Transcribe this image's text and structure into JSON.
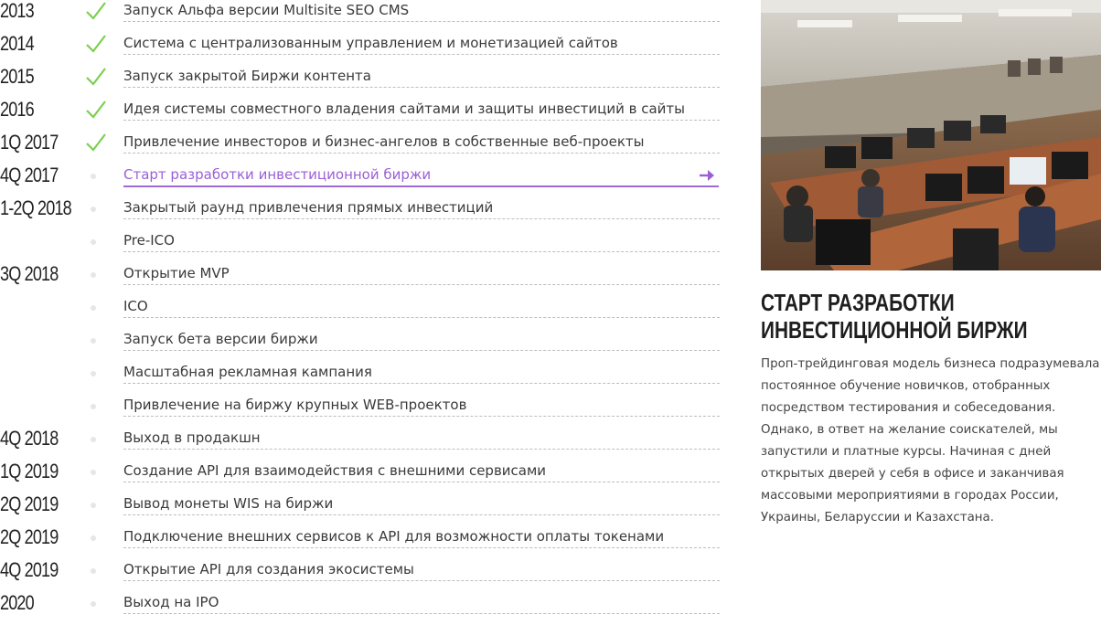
{
  "roadmap": {
    "rows": [
      {
        "year": "2013",
        "task": "Запуск Альфа версии Multisite SEO CMS",
        "status": "done"
      },
      {
        "year": "2014",
        "task": "Система с централизованным управлением и монетизацией сайтов",
        "status": "done"
      },
      {
        "year": "2015",
        "task": "Запуск закрытой Биржи контента",
        "status": "done"
      },
      {
        "year": "2016",
        "task": "Идея системы совместного владения сайтами и защиты инвестиций в сайты",
        "status": "done"
      },
      {
        "year": "1Q 2017",
        "task": "Привлечение инвесторов и бизнес-ангелов в собственные веб-проекты",
        "status": "done"
      },
      {
        "year": "4Q 2017",
        "task": "Старт разработки инвестиционной биржи",
        "status": "active"
      },
      {
        "year": "1-2Q 2018",
        "task": "Закрытый раунд привлечения прямых инвестиций",
        "status": "planned"
      },
      {
        "year": "",
        "task": "Pre-ICO",
        "status": "planned"
      },
      {
        "year": "3Q 2018",
        "task": "Открытие MVP",
        "status": "planned"
      },
      {
        "year": "",
        "task": "ICO",
        "status": "planned"
      },
      {
        "year": "",
        "task": "Запуск бета версии биржи",
        "status": "planned"
      },
      {
        "year": "",
        "task": "Масштабная рекламная кампания",
        "status": "planned"
      },
      {
        "year": "",
        "task": "Привлечение на биржу крупных WEB-проектов",
        "status": "planned"
      },
      {
        "year": "4Q 2018",
        "task": "Выход в продакшн",
        "status": "planned"
      },
      {
        "year": "1Q 2019",
        "task": "Создание API для взаимодействия с внешними сервисами",
        "status": "planned"
      },
      {
        "year": "2Q 2019",
        "task": "Вывод монеты WIS на биржи",
        "status": "planned"
      },
      {
        "year": "2Q 2019",
        "task": "Подключение внешних сервисов к API для возможности оплаты токенами",
        "status": "planned"
      },
      {
        "year": "4Q 2019",
        "task": "Открытие API для создания экосистемы",
        "status": "planned"
      },
      {
        "year": "2020",
        "task": "Выход на IPO",
        "status": "planned"
      }
    ]
  },
  "detail": {
    "title": "Старт разработки инвестиционной биржи",
    "text": "Проп-трейдинговая модель бизнеса подразумевала постоянное обучение новичков, отобранных посредством тестирования и собеседования. Однако, в ответ на желание соискателей, мы запустили и платные курсы. Начиная с дней открытых дверей у себя в офисе и заканчивая массовыми мероприятиями в городах России, Украины, Беларуссии и Казахстана."
  },
  "colors": {
    "accent": "#9a5fd6",
    "check": "#7ccf4f",
    "dot": "#e6e6e6"
  },
  "icons": {
    "done": "checkmark-icon",
    "planned": "dot-icon",
    "active": "arrow-right-icon"
  }
}
